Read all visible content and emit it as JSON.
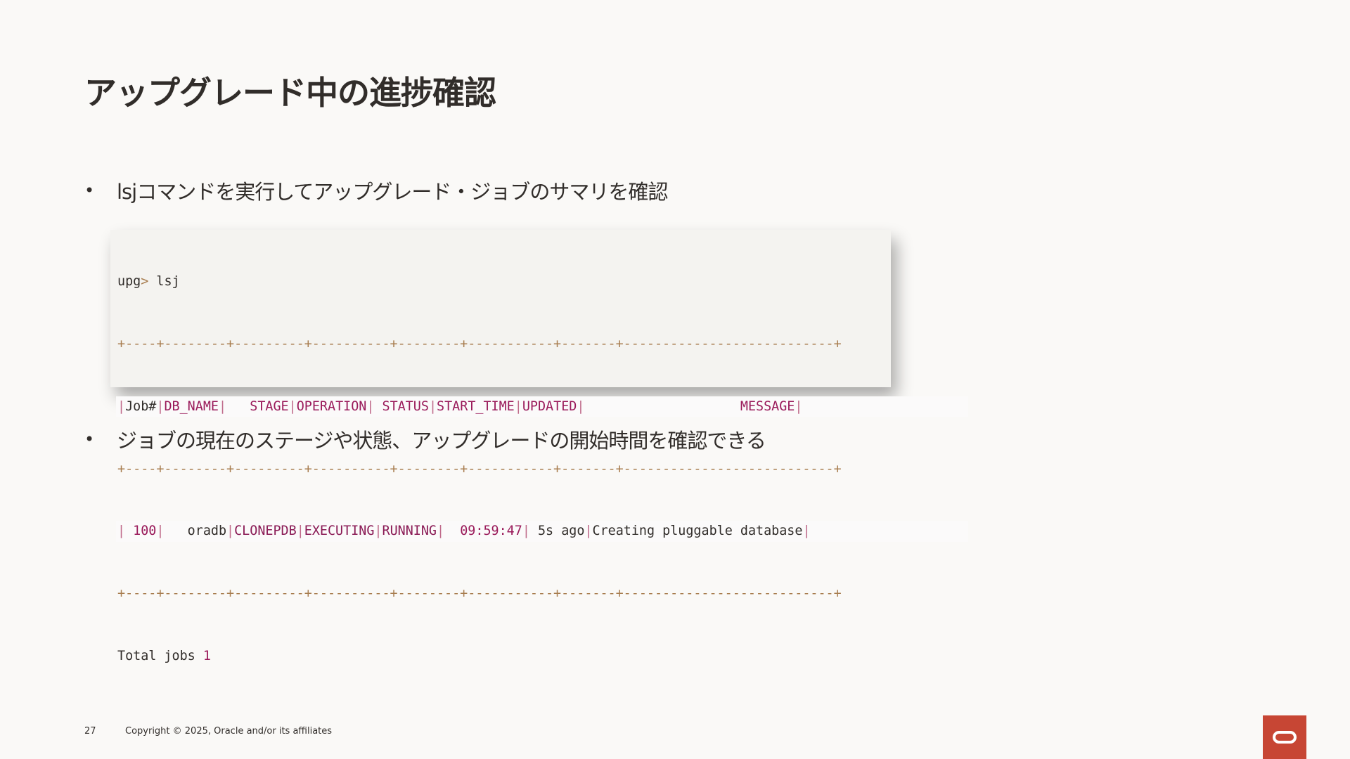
{
  "slide": {
    "title": "アップグレード中の進捗確認",
    "bullets": [
      "lsjコマンドを実行してアップグレード・ジョブのサマリを確認",
      "ジョブの現在のステージや状態、アップグレードの開始時間を確認できる"
    ],
    "bullet_symbol": "•"
  },
  "terminal": {
    "prompt": "upg",
    "prompt_symbol": ">",
    "command": "lsj",
    "separator": "+----+--------+---------+----------+--------+-----------+-------+---------------------------+",
    "headers": [
      "Job#",
      "DB_NAME",
      "   STAGE",
      "OPERATION",
      " STATUS",
      "START_TIME",
      "UPDATED",
      "                    MESSAGE"
    ],
    "row": {
      "job": " 100",
      "db_name": "   oradb",
      "stage": "CLONEPDB",
      "operation": "EXECUTING",
      "status": "RUNNING",
      "start_time": "  09:59:47",
      "updated": " 5s ago",
      "message": "Creating pluggable database"
    },
    "total_label": "Total jobs",
    "total_value": "1"
  },
  "footer": {
    "page_number": "27",
    "copyright": "Copyright © 2025, Oracle and/or its affiliates"
  },
  "colors": {
    "background": "#faf9f7",
    "brand_red": "#c74634",
    "terminal_bg": "#f4f3f0",
    "separator": "#a87d4f",
    "highlight": "#9a1a5a"
  },
  "icons": {
    "logo": "oracle-logo-icon"
  }
}
